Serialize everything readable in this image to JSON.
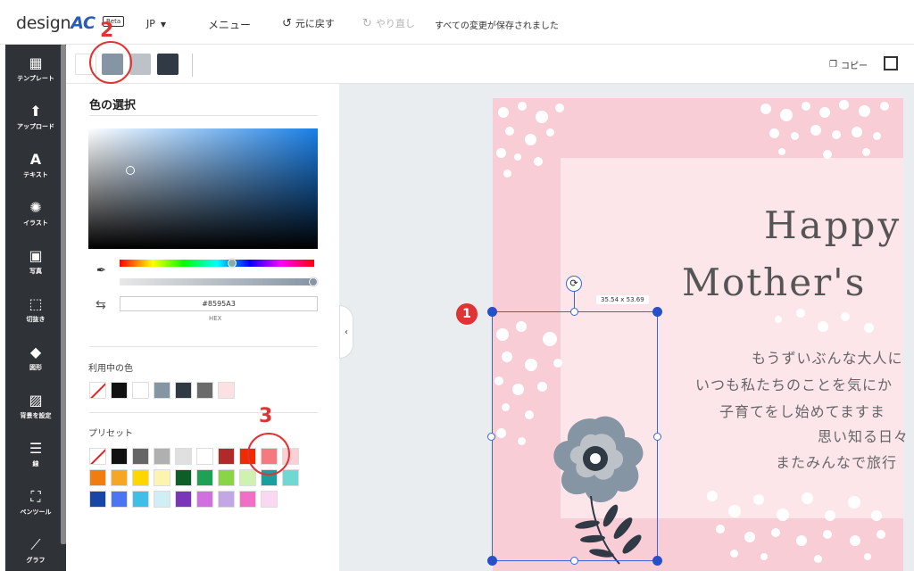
{
  "topbar": {
    "logo_text": "design",
    "logo_accent": "AC",
    "beta": "Beta",
    "language": "JP",
    "menu": "メニュー",
    "undo": "元に戻す",
    "redo": "やり直し",
    "saved_status": "すべての変更が保存されました"
  },
  "sidebar": {
    "items": [
      {
        "label": "テンプレート",
        "icon": "template-icon"
      },
      {
        "label": "アップロード",
        "icon": "upload-icon"
      },
      {
        "label": "テキスト",
        "icon": "text-icon"
      },
      {
        "label": "イラスト",
        "icon": "illustration-icon"
      },
      {
        "label": "写真",
        "icon": "photo-icon"
      },
      {
        "label": "切抜き",
        "icon": "crop-icon"
      },
      {
        "label": "図形",
        "icon": "shape-icon"
      },
      {
        "label": "背景を設定",
        "icon": "background-icon"
      },
      {
        "label": "線",
        "icon": "line-icon"
      },
      {
        "label": "ペンツール",
        "icon": "pen-tool-icon"
      },
      {
        "label": "グラフ",
        "icon": "graph-icon"
      }
    ]
  },
  "toolbar": {
    "swatches": [
      "#ffffff",
      "#8595a3",
      "#bcc2c8",
      "#2f3a45"
    ],
    "copy": "コピー"
  },
  "color_panel": {
    "title": "色の選択",
    "hex_value": "#8595A3",
    "hex_label": "HEX",
    "in_use_label": "利用中の色",
    "in_use_colors": [
      "none",
      "#111111",
      "#ffffff",
      "#8595a3",
      "#2f3a45",
      "#6b6b6b",
      "#fbe0e4"
    ],
    "preset_label": "プリセット",
    "preset_colors": [
      [
        "none",
        "#111111",
        "#666666",
        "#b0b0b0",
        "#e0e0e0",
        "#ffffff",
        "#b02a2a",
        "#f22a00",
        "#f47a80",
        "#fbd0d5"
      ],
      [
        "#f07d10",
        "#f5a623",
        "#ffd600",
        "#fff3b0",
        "#0e5e2a",
        "#1ea055",
        "#8bd347",
        "#cff2b0",
        "#1a9fa0",
        "#6fd8d0"
      ],
      [
        "#1845a8",
        "#4a76f2",
        "#3fbfe8",
        "#cfeff5",
        "#7a35b8",
        "#d26fe0",
        "#c2a6e6",
        "#f06fc4",
        "#fbd7f2"
      ]
    ]
  },
  "canvas": {
    "title_line1": "Happy",
    "title_line2": "Mother's",
    "message_lines": [
      "もうずいぶんな大人に",
      "いつも私たちのことを気にか",
      "子育てをし始めてますま",
      "思い知る日々",
      "またみんなで旅行"
    ],
    "selection_size": "35.54 x 53.69"
  },
  "annotations": [
    "1",
    "2",
    "3"
  ]
}
